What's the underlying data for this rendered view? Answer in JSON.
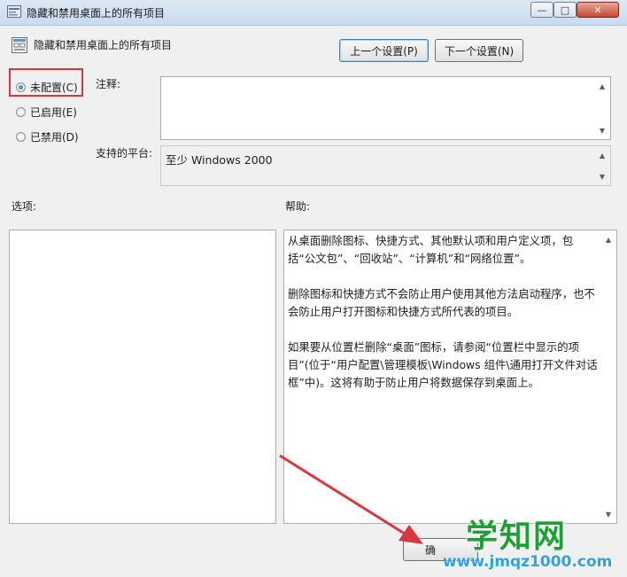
{
  "window": {
    "title": "隐藏和禁用桌面上的所有项目",
    "minimize_glyph": "—",
    "maximize_glyph": "□",
    "close_glyph": "✕"
  },
  "header": {
    "setting_name": "隐藏和禁用桌面上的所有项目",
    "prev_button": "上一个设置(P)",
    "next_button": "下一个设置(N)"
  },
  "radios": [
    {
      "label": "未配置(C)",
      "selected": true
    },
    {
      "label": "已启用(E)",
      "selected": false
    },
    {
      "label": "已禁用(D)",
      "selected": false
    }
  ],
  "comment": {
    "label": "注释:",
    "value": ""
  },
  "platform": {
    "label": "支持的平台:",
    "value": "至少 Windows 2000"
  },
  "options": {
    "label": "选项:"
  },
  "help": {
    "label": "帮助:",
    "paragraphs": [
      "从桌面删除图标、快捷方式、其他默认项和用户定义项，包括“公文包”、“回收站”、“计算机”和“网络位置”。",
      "删除图标和快捷方式不会防止用户使用其他方法启动程序，也不会防止用户打开图标和快捷方式所代表的项目。",
      "如果要从位置栏删除“桌面”图标，请参阅“位置栏中显示的项目”(位于“用户配置\\管理模板\\Windows 组件\\通用打开文件对话框”中)。这将有助于防止用户将数据保存到桌面上。"
    ]
  },
  "footer": {
    "ok_button_partial": "确"
  },
  "watermark": {
    "logo": "学知网",
    "url": "www.jmqz1000.com"
  },
  "colors": {
    "annotation_red": "#d9363e",
    "watermark_green": "#1aa333",
    "watermark_blue": "#2ea3e0"
  }
}
